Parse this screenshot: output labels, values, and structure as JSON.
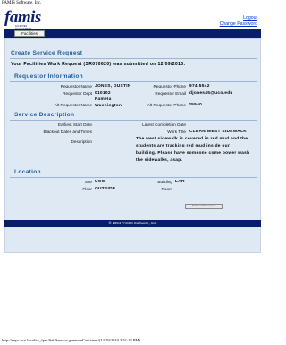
{
  "browser": {
    "page_title": "FAMIS Software, Inc.",
    "url_footer": "http://enyo.uco.local/cs_fpm/SelfService.generateContainer/(12/29/2010 3:51:22 PM)"
  },
  "header": {
    "logo_text": "famis",
    "logo_sub": "FACILITIES MANAGEMENT INFORMATION SYSTEM",
    "links": [
      "Logout",
      "Change Password"
    ]
  },
  "nav": {
    "tab": "Facilities Services"
  },
  "request": {
    "title": "Create Service Request",
    "subtitle": "Your Facilities Work Request (SR070620) was submitted on 12/09/2010."
  },
  "requestor": {
    "heading": "Requestor Information",
    "name_label": "Requestor Name",
    "name": "JONES, DUSTIN",
    "phone_label": "Requestor Phone",
    "phone": "974-5542",
    "dept_label": "Requestor Dept",
    "dept": "010102",
    "email_label": "Requestor Email",
    "email": "djones45@uco.edu",
    "alt_name_label": "Alt Requestor Name",
    "alt_name_line1": "Pamela",
    "alt_name_line2": "Washington",
    "alt_phone_label": "Alt Requestor Phone",
    "alt_phone": "*5540"
  },
  "service": {
    "heading": "Service Description",
    "earliest_label": "Earliest Start Date",
    "earliest": "",
    "latest_label": "Latest Completion Date",
    "latest": "",
    "blackout_label": "Blackout Dates and Times",
    "blackout": "",
    "work_title_label": "Work Title",
    "work_title": "CLEAN WEST SIDEWALK",
    "description_label": "Description",
    "description": "The west sidewalk is covered in red mud and the students are tracking red mud inside our building. Please have someone come power wash the sidewalks, asap."
  },
  "location": {
    "heading": "Location",
    "site_label": "Site",
    "site": "UCO",
    "building_label": "Building",
    "building": "LAR",
    "floor_label": "Floor",
    "floor": "OUTSIDE",
    "room_label": "Room",
    "room": "",
    "button": "Submit another request"
  },
  "footer": {
    "copyright": "© 2004 FAMIS Software, Inc."
  }
}
